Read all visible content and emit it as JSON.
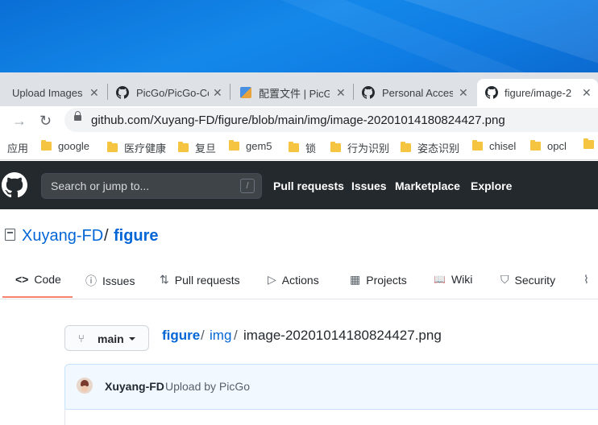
{
  "browser": {
    "tabs": [
      {
        "title": "Upload Images",
        "close": "✕",
        "favicon": "none-icon"
      },
      {
        "title": "PicGo/PicGo-Co",
        "close": "✕",
        "favicon": "github-icon"
      },
      {
        "title": "配置文件 | PicGo",
        "close": "✕",
        "favicon": "doc-icon"
      },
      {
        "title": "Personal Acces",
        "close": "✕",
        "favicon": "github-icon"
      },
      {
        "title": "figure/image-2",
        "close": "✕",
        "favicon": "github-icon"
      }
    ],
    "nav": {
      "forward": "→",
      "reload": "↻"
    },
    "url": "github.com/Xuyang-FD/figure/blob/main/img/image-20201014180824427.png",
    "bookmarks": [
      "应用",
      "google",
      "医疗健康",
      "复旦",
      "gem5",
      "锁",
      "行为识别",
      "姿态识别",
      "chisel",
      "opcl"
    ]
  },
  "github": {
    "search_placeholder": "Search or jump to...",
    "search_shortcut": "/",
    "nav": [
      "Pull requests",
      "Issues",
      "Marketplace",
      "Explore"
    ],
    "repo": {
      "owner": "Xuyang-FD",
      "separator": "/",
      "name": "figure"
    },
    "repo_tabs": [
      {
        "label": "Code",
        "icon": "<>"
      },
      {
        "label": "Issues",
        "icon": "ⓘ"
      },
      {
        "label": "Pull requests",
        "icon": "⇅"
      },
      {
        "label": "Actions",
        "icon": "▷"
      },
      {
        "label": "Projects",
        "icon": "▦"
      },
      {
        "label": "Wiki",
        "icon": "📖"
      },
      {
        "label": "Security",
        "icon": "⛉"
      }
    ],
    "branch": "main",
    "breadcrumb": {
      "root": "figure",
      "folder": "img",
      "sep": "/",
      "file": "image-20201014180824427.png"
    },
    "commit": {
      "author": "Xuyang-FD",
      "message": "Upload by PicGo"
    }
  },
  "colors": {
    "header_bg": "#24292e",
    "link": "#0366d6",
    "active_tab_underline": "#f9826c",
    "commit_bg": "#f1f8ff"
  }
}
